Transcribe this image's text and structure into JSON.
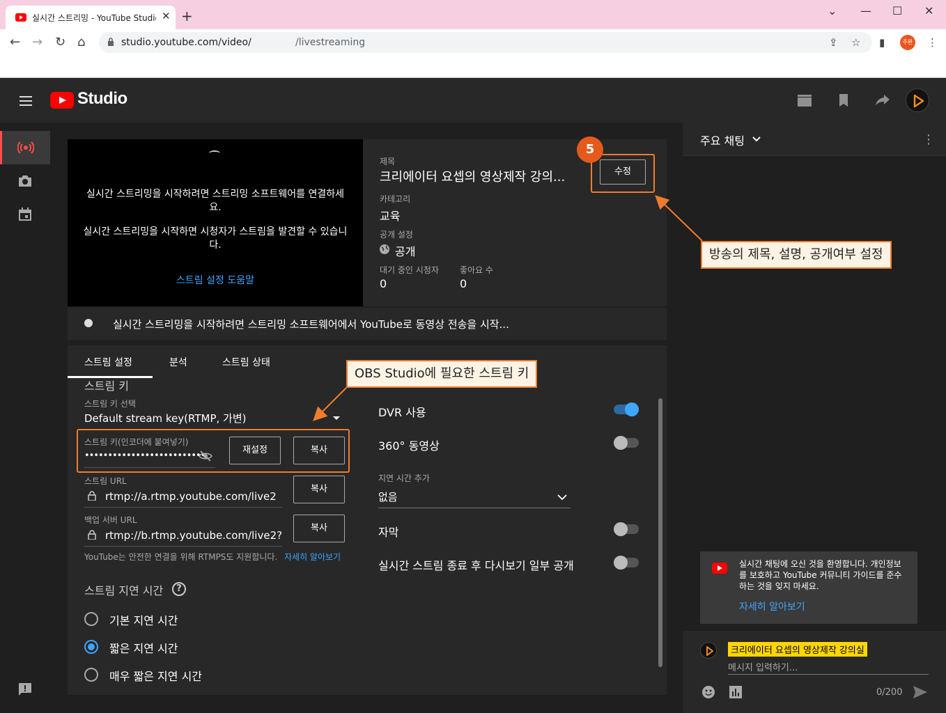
{
  "browser": {
    "tab_title": "실시간 스트리밍 - YouTube Studio",
    "tab_close": "✕",
    "new_tab": "+",
    "url_prefix": "studio.youtube.com/video/",
    "url_suffix": "/livestreaming",
    "profile_label": "주완",
    "window_controls": [
      "⌄",
      "—",
      "☐",
      "✕"
    ]
  },
  "studio": {
    "brand": "Studio"
  },
  "preview": {
    "message1": "실시간 스트리밍을 시작하려면 스트리밍 소프트웨어를 연결하세요.",
    "message2": "실시간 스트리밍을 시작하면 시청자가 스트림을 발견할 수 있습니다.",
    "help_link": "스트림 설정 도움말"
  },
  "info": {
    "title_label": "제목",
    "title_value": "크리에이터 요셉의 영상제작 강의...",
    "edit_button": "수정",
    "category_label": "카테고리",
    "category_value": "교육",
    "visibility_label": "공개 설정",
    "visibility_value": "공개",
    "waiting_label": "대기 중인 시청자",
    "waiting_value": "0",
    "likes_label": "좋아요 수",
    "likes_value": "0"
  },
  "status": {
    "text": "실시간 스트리밍을 시작하려면 스트리밍 소프트웨어에서 YouTube로 동영상 전송을 시작..."
  },
  "tabs": [
    "스트림 설정",
    "분석",
    "스트림 상태"
  ],
  "stream_settings": {
    "section_title": "스트림 키",
    "key_select_label": "스트림 키 선택",
    "key_select_value": "Default stream key(RTMP, 가변)",
    "key_label": "스트림 키(인코더에 붙여넣기)",
    "key_value": "••••••••••••••••••••••••••",
    "reset_button": "재설정",
    "copy_button": "복사",
    "url_label": "스트림 URL",
    "url_value": "rtmp://a.rtmp.youtube.com/live2",
    "backup_label": "백업 서버 URL",
    "backup_value": "rtmp://b.rtmp.youtube.com/live2?",
    "rtmps_note": "YouTube는 안전한 연결을 위해 RTMPS도 지원합니다.",
    "rtmps_link": "자세히 알아보기",
    "latency_title": "스트림 지연 시간",
    "latency_help": "?",
    "latency_options": [
      {
        "label": "기본 지연 시간",
        "selected": false
      },
      {
        "label": "짧은 지연 시간",
        "selected": true
      },
      {
        "label": "매우 짧은 지연 시간",
        "selected": false
      }
    ]
  },
  "options": {
    "dvr": {
      "label": "DVR 사용",
      "on": true
    },
    "vr360": {
      "label": "360° 동영상",
      "on": false
    },
    "delay_label": "지연 시간 추가",
    "delay_value": "없음",
    "captions": {
      "label": "자막",
      "on": false
    },
    "replay": {
      "label": "실시간 스트림 종료 후 다시보기 일부 공개",
      "on": false
    }
  },
  "chat": {
    "title": "주요 채팅",
    "welcome": "실시간 채팅에 오신 것을 환영합니다. 개인정보를 보호하고 YouTube 커뮤니티 가이드를 준수하는 것을 잊지 마세요.",
    "welcome_link": "자세히 알아보기",
    "username": "크리에이터 요셉의 영상제작 강의실",
    "input_placeholder": "메시지 입력하기...",
    "char_count": "0/200"
  },
  "annotations": {
    "step_number": "5",
    "callout_edit": "방송의 제목, 설명, 공개여부 설정",
    "callout_key": "OBS Studio에 필요한 스트림 키",
    "accent_color": "#f07c2c"
  }
}
